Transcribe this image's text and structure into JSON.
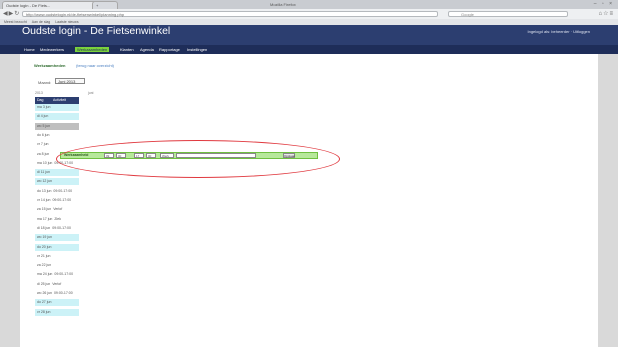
{
  "browser": {
    "tabs": [
      {
        "label": "Oudste login - De Fiets..."
      },
      {
        "label": "+"
      }
    ],
    "window_title": "Mozilla Firefox",
    "window_buttons": "– ▫ ×",
    "url": "http://www.oudstelogin.nl/de-fietsenwinkel/planning.php",
    "search_placeholder": "Google",
    "bookmarks": [
      "Meest bezocht",
      "Aan de slag",
      "Laatste nieuws"
    ]
  },
  "header": {
    "title": "Oudste login - De Fietsenwinkel",
    "user_info": "Ingelogd als: beheerder · Uitloggen",
    "nav": [
      {
        "label": "Home"
      },
      {
        "label": "Medewerkers"
      },
      {
        "label": "Werkzaamheden"
      },
      {
        "label": "Klanten"
      },
      {
        "label": "Agenda"
      },
      {
        "label": "Rapportage"
      },
      {
        "label": "Instellingen"
      }
    ],
    "active_nav": "Werkzaamheden"
  },
  "main": {
    "title": "Werkzaamheden",
    "subtitle": "(terug naar overzicht)",
    "month_label": "Maand:",
    "month_value": "Juni 2013",
    "year_left": "2013",
    "year_right": "juni",
    "columns": [
      "Dag",
      "Activiteit"
    ],
    "days": [
      {
        "day": "ma 3 jun",
        "detail": "",
        "style": "cyan"
      },
      {
        "day": "di 4 jun",
        "detail": "",
        "style": "cyan"
      },
      {
        "day": "wo 5 jun",
        "detail": "",
        "style": "gray"
      },
      {
        "day": "do 6 jun",
        "detail": "",
        "style": "white"
      },
      {
        "day": "vr 7 jun",
        "detail": "",
        "style": "white"
      },
      {
        "day": "za 8 jun",
        "detail": "",
        "style": "white"
      },
      {
        "day": "ma 10 jun",
        "detail": "09:00-17:00",
        "style": "white"
      },
      {
        "day": "di 11 jun",
        "detail": "",
        "style": "cyan"
      },
      {
        "day": "wo 12 jun",
        "detail": "",
        "style": "cyan"
      },
      {
        "day": "do 13 jun",
        "detail": "09:00-17:00",
        "style": "white"
      },
      {
        "day": "vr 14 jun",
        "detail": "09:00-17:00",
        "style": "white"
      },
      {
        "day": "za 15 jun",
        "detail": "Verlof",
        "style": "white"
      },
      {
        "day": "ma 17 jun",
        "detail": "Ziek",
        "style": "white"
      },
      {
        "day": "di 18 jun",
        "detail": "09:00-17:00",
        "style": "white"
      },
      {
        "day": "wo 19 jun",
        "detail": "",
        "style": "cyan"
      },
      {
        "day": "do 20 jun",
        "detail": "",
        "style": "cyan"
      },
      {
        "day": "vr 21 jun",
        "detail": "",
        "style": "white"
      },
      {
        "day": "za 22 jun",
        "detail": "",
        "style": "white"
      },
      {
        "day": "ma 24 jun",
        "detail": "09:00-17:00",
        "style": "white"
      },
      {
        "day": "di 25 jun",
        "detail": "Verlof",
        "style": "white"
      },
      {
        "day": "wo 26 jun",
        "detail": "09:00-17:00",
        "style": "white"
      },
      {
        "day": "do 27 jun",
        "detail": "",
        "style": "cyan"
      },
      {
        "day": "vr 28 jun",
        "detail": "",
        "style": "cyan"
      }
    ],
    "form": {
      "label": "Werkzaamheid",
      "start_hour": "09",
      "start_min": "00",
      "end_hour": "17",
      "end_min": "00",
      "activity": "Werk",
      "note": "",
      "save_label": "Opslaan"
    }
  },
  "colors": {
    "header_bg": "#2c3e70",
    "nav_bg": "#1e2d59",
    "active_nav": "#7bd23c",
    "row_cyan": "#ccf2f7",
    "form_bg": "#b7e89b",
    "highlight": "#e0393f"
  }
}
